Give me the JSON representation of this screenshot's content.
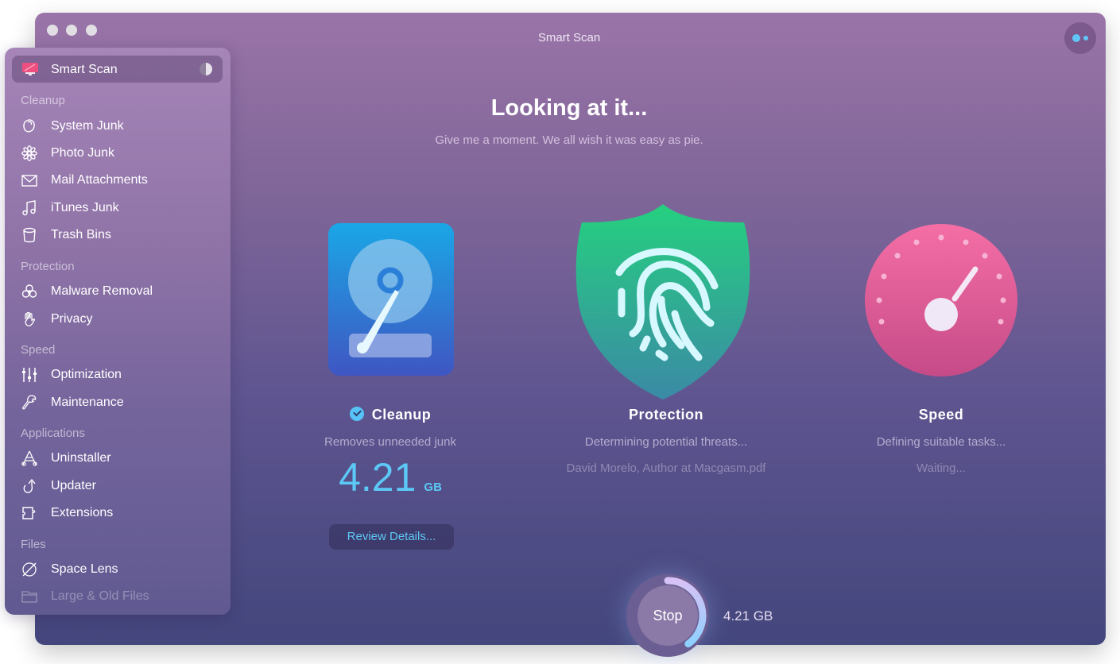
{
  "window": {
    "title": "Smart Scan"
  },
  "sidebar": {
    "active": {
      "label": "Smart Scan",
      "icon": "monitor-icon"
    },
    "sections": [
      {
        "title": "Cleanup",
        "items": [
          {
            "label": "System Junk",
            "icon": "system-junk-icon"
          },
          {
            "label": "Photo Junk",
            "icon": "flower-icon"
          },
          {
            "label": "Mail Attachments",
            "icon": "envelope-icon"
          },
          {
            "label": "iTunes Junk",
            "icon": "music-note-icon"
          },
          {
            "label": "Trash Bins",
            "icon": "trash-bin-icon"
          }
        ]
      },
      {
        "title": "Protection",
        "items": [
          {
            "label": "Malware Removal",
            "icon": "biohazard-icon"
          },
          {
            "label": "Privacy",
            "icon": "hand-icon"
          }
        ]
      },
      {
        "title": "Speed",
        "items": [
          {
            "label": "Optimization",
            "icon": "sliders-icon"
          },
          {
            "label": "Maintenance",
            "icon": "wrench-icon"
          }
        ]
      },
      {
        "title": "Applications",
        "items": [
          {
            "label": "Uninstaller",
            "icon": "uninstaller-icon"
          },
          {
            "label": "Updater",
            "icon": "update-arrow-icon"
          },
          {
            "label": "Extensions",
            "icon": "puzzle-icon"
          }
        ]
      },
      {
        "title": "Files",
        "items": [
          {
            "label": "Space Lens",
            "icon": "planet-icon"
          },
          {
            "label": "Large & Old Files",
            "icon": "folder-icon"
          }
        ]
      }
    ]
  },
  "main": {
    "headline": "Looking at it...",
    "subline": "Give me a moment. We all wish it was easy as pie.",
    "modules": [
      {
        "title": "Cleanup",
        "description": "Removes unneeded junk",
        "value": "4.21",
        "unit": "GB",
        "button": "Review Details...",
        "status": "complete"
      },
      {
        "title": "Protection",
        "description": "Determining potential threats...",
        "detail": "David Morelo, Author at Macgasm.pdf"
      },
      {
        "title": "Speed",
        "description": "Defining suitable tasks...",
        "detail": "Waiting..."
      }
    ],
    "stop_button": "Stop",
    "progress_fraction": 0.4,
    "total_size": "4.21 GB"
  },
  "colors": {
    "accent_blue": "#5cc8f5",
    "progress_start": "#d8c2f5",
    "progress_end": "#8fd0ff"
  }
}
